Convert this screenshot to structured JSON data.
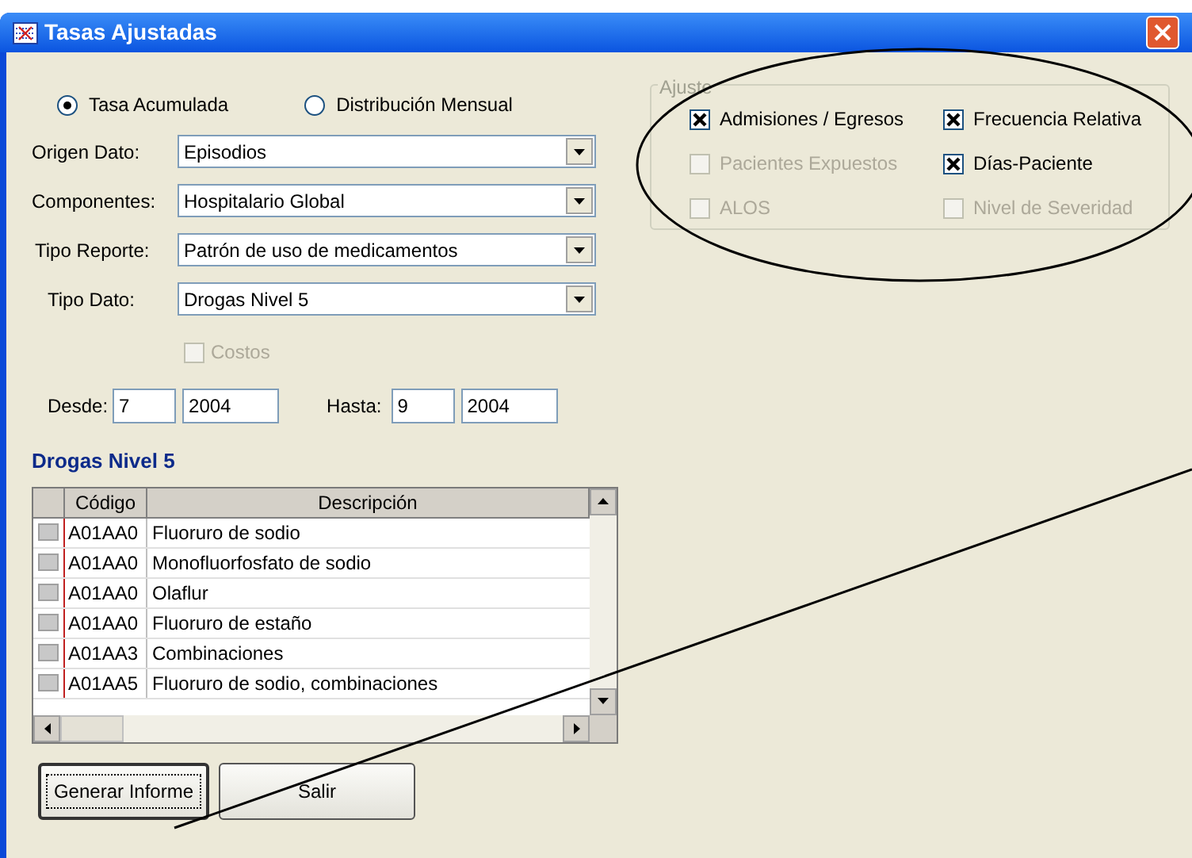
{
  "window": {
    "title": "Tasas Ajustadas"
  },
  "mode_options": [
    {
      "label": "Tasa Acumulada",
      "selected": true
    },
    {
      "label": "Distribución Mensual",
      "selected": false
    }
  ],
  "fields": [
    {
      "label": "Origen Dato:",
      "value": "Episodios"
    },
    {
      "label": "Componentes:",
      "value": "Hospitalario Global"
    },
    {
      "label": "Tipo Reporte:",
      "value": "Patrón de uso de medicamentos"
    },
    {
      "label": "Tipo Dato:",
      "value": "Drogas Nivel 5"
    }
  ],
  "costos": {
    "label": "Costos",
    "checked": false,
    "disabled": true
  },
  "date_range": {
    "from_label": "Desde:",
    "from_month": "7",
    "from_year": "2004",
    "to_label": "Hasta:",
    "to_month": "9",
    "to_year": "2004"
  },
  "section_title": "Drogas Nivel 5",
  "table": {
    "columns": [
      "Código",
      "Descripción"
    ],
    "rows": [
      {
        "code": "A01AA0",
        "description": "Fluoruro de sodio"
      },
      {
        "code": "A01AA0",
        "description": "Monofluorfosfato de sodio"
      },
      {
        "code": "A01AA0",
        "description": "Olaflur"
      },
      {
        "code": "A01AA0",
        "description": "Fluoruro de estaño"
      },
      {
        "code": "A01AA3",
        "description": "Combinaciones"
      },
      {
        "code": "A01AA5",
        "description": "Fluoruro de sodio, combinaciones"
      }
    ]
  },
  "buttons": [
    {
      "label": "Generar Informe",
      "focused": true
    },
    {
      "label": "Salir",
      "focused": false
    }
  ],
  "ajuste": {
    "title": "Ajuste",
    "options": [
      {
        "label": "Admisiones / Egresos",
        "checked": true,
        "disabled": false
      },
      {
        "label": "Frecuencia Relativa",
        "checked": true,
        "disabled": false
      },
      {
        "label": "Pacientes Expuestos",
        "checked": false,
        "disabled": true
      },
      {
        "label": "Días-Paciente",
        "checked": true,
        "disabled": false
      },
      {
        "label": "ALOS",
        "checked": false,
        "disabled": true
      },
      {
        "label": "Nivel de Severidad",
        "checked": false,
        "disabled": true
      }
    ]
  }
}
